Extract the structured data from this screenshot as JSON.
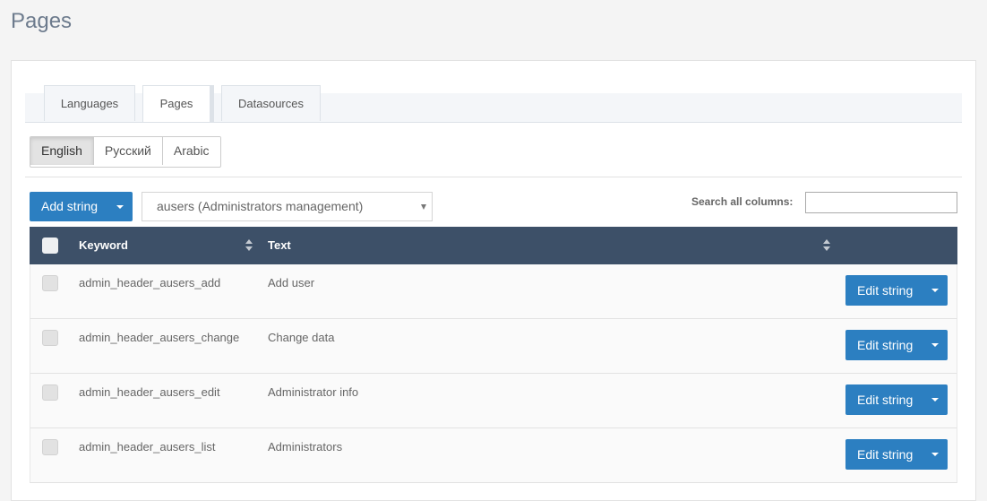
{
  "page": {
    "title": "Pages"
  },
  "tabs": [
    {
      "label": "Languages"
    },
    {
      "label": "Pages"
    },
    {
      "label": "Datasources"
    }
  ],
  "languages": [
    {
      "label": "English"
    },
    {
      "label": "Русский"
    },
    {
      "label": "Arabic"
    }
  ],
  "toolbar": {
    "add_label": "Add string",
    "select_value": "ausers (Administrators management)",
    "search_label": "Search all columns:",
    "search_value": ""
  },
  "table": {
    "columns": {
      "keyword": "Keyword",
      "text": "Text"
    },
    "rows": [
      {
        "keyword": "admin_header_ausers_add",
        "text": "Add user",
        "action": "Edit string"
      },
      {
        "keyword": "admin_header_ausers_change",
        "text": "Change data",
        "action": "Edit string"
      },
      {
        "keyword": "admin_header_ausers_edit",
        "text": "Administrator info",
        "action": "Edit string"
      },
      {
        "keyword": "admin_header_ausers_list",
        "text": "Administrators",
        "action": "Edit string"
      }
    ]
  },
  "colors": {
    "primary": "#2c7fc1",
    "table_header": "#3d5068"
  }
}
